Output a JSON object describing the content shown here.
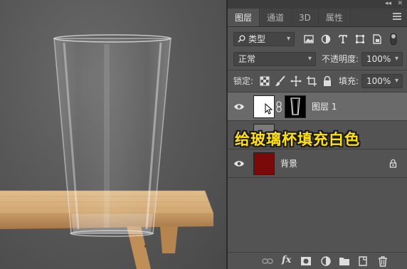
{
  "window": {
    "collapse_glyph": "◂◂",
    "close_glyph": "✕"
  },
  "tabs": [
    {
      "label": "图层",
      "active": true
    },
    {
      "label": "通道",
      "active": false
    },
    {
      "label": "3D",
      "active": false
    },
    {
      "label": "属性",
      "active": false
    }
  ],
  "filter": {
    "label": "类型",
    "icons": [
      "image-filter-icon",
      "adjustment-filter-icon",
      "text-filter-icon",
      "shape-filter-icon",
      "smart-object-filter-icon",
      "filter-toggle-icon"
    ]
  },
  "blend": {
    "mode": "正常",
    "opacity_label": "不透明度:",
    "opacity_value": "100%"
  },
  "lock": {
    "label": "锁定:",
    "fill_label": "填充:",
    "fill_value": "100%"
  },
  "layers": [
    {
      "name": "图层 1",
      "selected": true,
      "has_mask": true
    },
    {
      "name": "",
      "selected": false
    },
    {
      "name": "背景",
      "selected": false,
      "locked": true
    }
  ],
  "caption": "给玻璃杯填充白色",
  "colors": {
    "background_layer": "#7a0a0a",
    "caption": "#ffe016",
    "panel": "#535353"
  },
  "bottom_icons": [
    "link-layers-icon",
    "fx-icon",
    "add-mask-icon",
    "adjustment-layer-icon",
    "group-folder-icon",
    "new-layer-icon",
    "trash-icon"
  ],
  "fx_label": "fx"
}
